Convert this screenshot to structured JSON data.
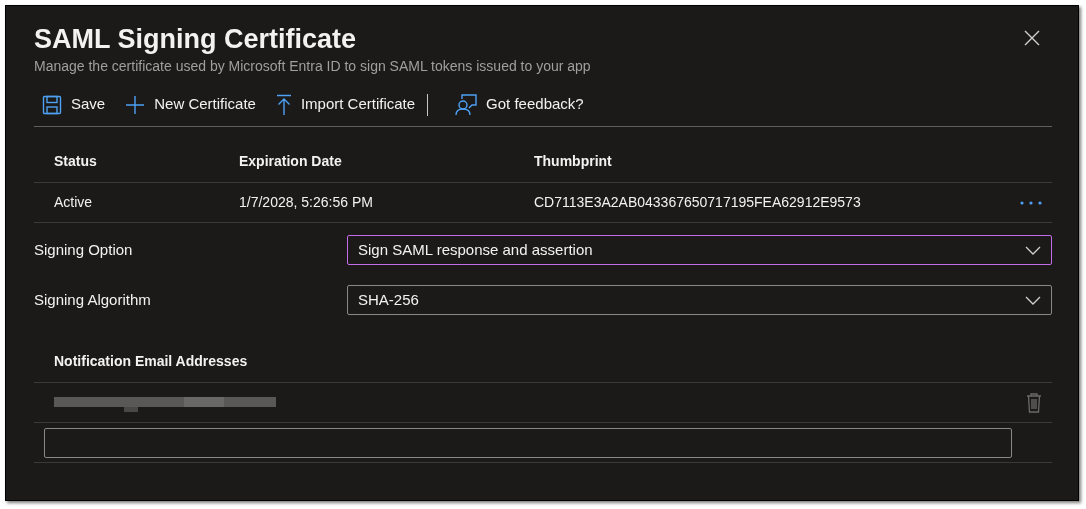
{
  "panel": {
    "title": "SAML Signing Certificate",
    "subtitle": "Manage the certificate used by Microsoft Entra ID to sign SAML tokens issued to your app"
  },
  "toolbar": [
    {
      "kind": "save",
      "label": "Save"
    },
    {
      "kind": "new",
      "label": "New Certificate"
    },
    {
      "kind": "import",
      "label": "Import Certificate"
    },
    {
      "kind": "feedback",
      "label": "Got feedback?"
    }
  ],
  "certificates": {
    "columns": [
      "Status",
      "Expiration Date",
      "Thumbprint"
    ],
    "rows": [
      {
        "cells": [
          "Active",
          "1/7/2028, 5:26:56 PM",
          "CD7113E3A2AB043367650717195FEA62912E9573"
        ]
      }
    ]
  },
  "settings": [
    {
      "label": "Signing Option",
      "value": "Sign SAML response and assertion",
      "focused": true
    },
    {
      "label": "Signing Algorithm",
      "value": "SHA-256",
      "focused": false
    }
  ],
  "notification_emails": {
    "heading": "Notification Email Addresses",
    "entries": [
      {
        "kind": "redacted"
      }
    ]
  }
}
